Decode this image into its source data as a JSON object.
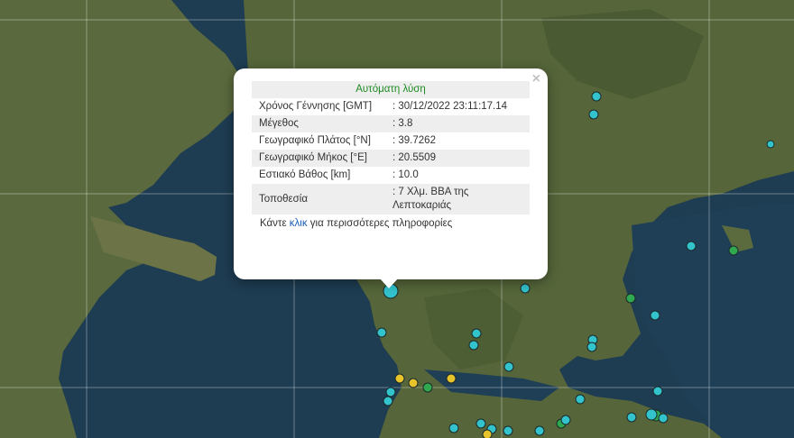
{
  "popup": {
    "title": "Αυτόματη λύση",
    "rows": [
      {
        "label": "Χρόνος Γέννησης [GMT]",
        "value": ": 30/12/2022 23:11:17.14"
      },
      {
        "label": "Μέγεθος",
        "value": ": 3.8"
      },
      {
        "label": "Γεωγραφικό Πλάτος [°N]",
        "value": ": 39.7262"
      },
      {
        "label": "Γεωγραφικό Μήκος [°E]",
        "value": ": 20.5509"
      },
      {
        "label": "Εστιακό Βάθος [km]",
        "value": ": 10.0"
      },
      {
        "label": "Τοποθεσία",
        "value": ": 7 Χλμ. ΒΒΑ της Λεπτοκαριάς"
      }
    ],
    "more_prefix": "Κάντε ",
    "more_link": "κλικ",
    "more_suffix": " για περισσότερες πληροφορίες",
    "close_symbol": "×"
  },
  "colors": {
    "sea": "#1e3c52",
    "land": "#55633c",
    "marker_cyan": "#33c3cc",
    "marker_green": "#2fa84f",
    "marker_yellow": "#e8c42c",
    "link": "#1a5fb4",
    "title_green": "#1e8a23"
  },
  "markers_note_icons": [
    "earthquake-marker-icon"
  ]
}
